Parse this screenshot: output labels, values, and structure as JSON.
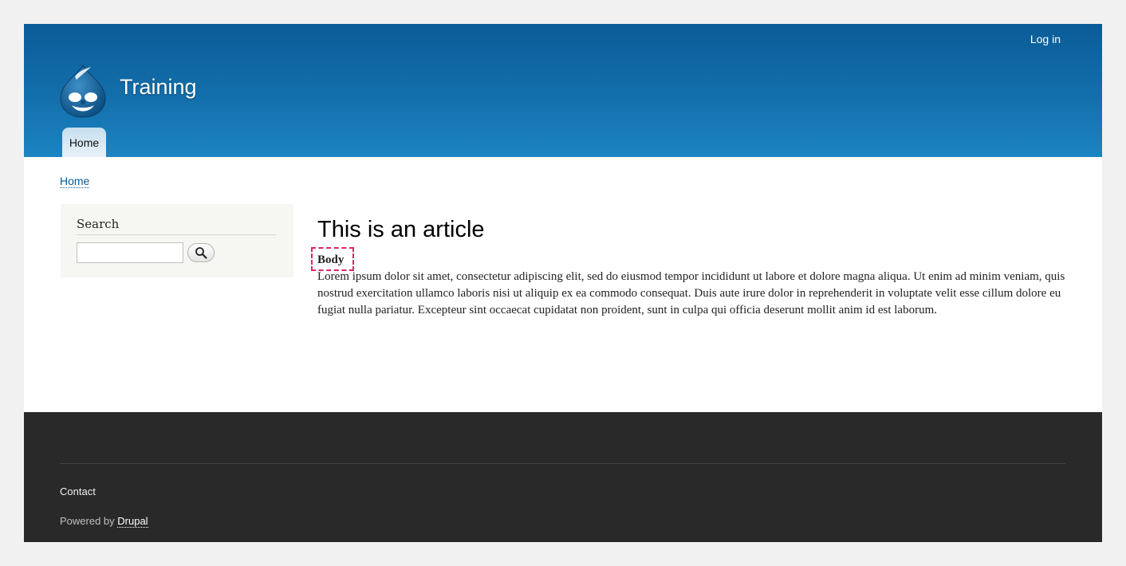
{
  "header": {
    "login_label": "Log in",
    "site_name": "Training",
    "nav": {
      "home_label": "Home"
    }
  },
  "breadcrumb": {
    "home_label": "Home"
  },
  "sidebar": {
    "search": {
      "title": "Search",
      "input_value": "",
      "button_icon": "magnifier-icon"
    }
  },
  "article": {
    "title": "This is an article",
    "field_label": "Body",
    "body": "Lorem ipsum dolor sit amet, consectetur adipiscing elit, sed do eiusmod tempor incididunt ut labore et dolore magna aliqua. Ut enim ad minim veniam, quis nostrud exercitation ullamco laboris nisi ut aliquip ex ea commodo consequat. Duis aute irure dolor in reprehenderit in voluptate velit esse cillum dolore eu fugiat nulla pariatur. Excepteur sint occaecat cupidatat non proident, sunt in culpa qui officia deserunt mollit anim id est laborum."
  },
  "footer": {
    "contact_label": "Contact",
    "powered_prefix": "Powered by ",
    "powered_link": "Drupal"
  },
  "colors": {
    "header_top": "#0a5c97",
    "header_bottom": "#1c84c3",
    "link": "#0a5a92",
    "footer_bg": "#292929",
    "highlight": "#e0245e"
  }
}
